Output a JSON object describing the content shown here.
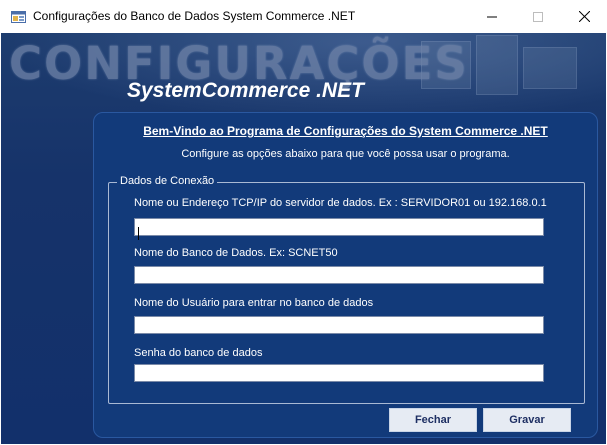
{
  "window": {
    "title": "Configurações do Banco de Dados System Commerce .NET",
    "icons": {
      "app": "window-app-icon",
      "minimize": "minimize-icon",
      "maximize": "maximize-icon",
      "close": "close-icon"
    }
  },
  "banner": {
    "title": "CONFIGURAÇÕES",
    "subtitle": "SystemCommerce .NET"
  },
  "panel": {
    "welcome": "Bem-Vindo ao Programa de Configurações do System Commerce .NET",
    "instruction": "Configure as opções abaixo para que você possa usar o programa."
  },
  "group": {
    "legend": "Dados de Conexão",
    "fields": [
      {
        "label": "Nome ou Endereço TCP/IP do servidor de dados. Ex : SERVIDOR01 ou 192.168.0.1",
        "value": ""
      },
      {
        "label": "Nome do Banco de Dados.  Ex: SCNET50",
        "value": ""
      },
      {
        "label": "Nome do Usuário para entrar no banco de dados",
        "value": ""
      },
      {
        "label": "Senha do banco de dados",
        "value": ""
      }
    ]
  },
  "buttons": {
    "close": "Fechar",
    "save": "Gravar"
  },
  "colors": {
    "background": "#16336a",
    "panel": "#123a7a",
    "button_text": "#1e2f63"
  }
}
